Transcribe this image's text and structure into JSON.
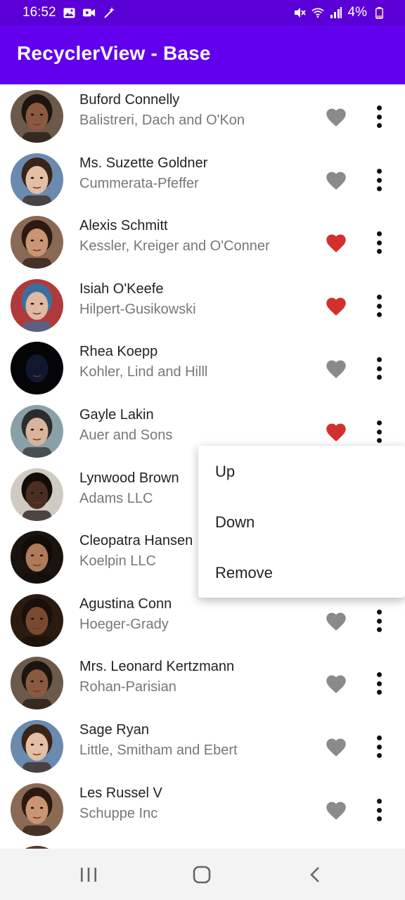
{
  "status_bar": {
    "time": "16:52",
    "battery": "4%",
    "left_icons": [
      "gallery-icon",
      "video-icon",
      "magic-wand-icon"
    ],
    "right_icons": [
      "mute-icon",
      "wifi-icon",
      "signal-icon",
      "battery-icon"
    ]
  },
  "app_bar": {
    "title": "RecyclerView - Base",
    "color": "#6200ee"
  },
  "list": {
    "items": [
      {
        "name": "Buford Connelly",
        "company": "Balistreri, Dach and O'Kon",
        "favorite": false,
        "skin": "#8a5a40",
        "hair": "#1e140e",
        "bg": "#6b5a4a"
      },
      {
        "name": "Ms. Suzette Goldner",
        "company": "Cummerata-Pfeffer",
        "favorite": false,
        "skin": "#e3bfa5",
        "hair": "#3a2418",
        "bg": "#6a8ab0"
      },
      {
        "name": "Alexis Schmitt",
        "company": "Kessler, Kreiger and O'Conner",
        "favorite": true,
        "skin": "#c99574",
        "hair": "#2a1a12",
        "bg": "#8a6a55"
      },
      {
        "name": "Isiah O'Keefe",
        "company": "Hilpert-Gusikowski",
        "favorite": true,
        "skin": "#e0b9a0",
        "hair": "#3b6fa0",
        "bg": "#b03a3a"
      },
      {
        "name": "Rhea Koepp",
        "company": "Kohler, Lind and Hilll",
        "favorite": false,
        "skin": "#101830",
        "hair": "#050508",
        "bg": "#050508"
      },
      {
        "name": "Gayle Lakin",
        "company": "Auer and Sons",
        "favorite": true,
        "skin": "#d9b39a",
        "hair": "#2c2c2c",
        "bg": "#8aa0a8"
      },
      {
        "name": "Lynwood Brown",
        "company": "Adams LLC",
        "favorite": false,
        "skin": "#4a2e22",
        "hair": "#150c08",
        "bg": "#cfcac2"
      },
      {
        "name": "Cleopatra Hansen",
        "company": "Koelpin LLC",
        "favorite": false,
        "skin": "#b07a5a",
        "hair": "#120c08",
        "bg": "#1a1410"
      },
      {
        "name": "Agustina Conn",
        "company": "Hoeger-Grady",
        "favorite": false,
        "skin": "#7a4a30",
        "hair": "#1a0f0a",
        "bg": "#2a1a10"
      },
      {
        "name": "Mrs. Leonard Kertzmann",
        "company": "Rohan-Parisian",
        "favorite": false,
        "skin": "#8a5a40",
        "hair": "#1e140e",
        "bg": "#6b5a4a"
      },
      {
        "name": "Sage Ryan",
        "company": "Little, Smitham and Ebert",
        "favorite": false,
        "skin": "#e3bfa5",
        "hair": "#3a2418",
        "bg": "#6a8ab0"
      },
      {
        "name": "Les Russel V",
        "company": "Schuppe Inc",
        "favorite": false,
        "skin": "#c99574",
        "hair": "#2a1a12",
        "bg": "#8a6a55"
      }
    ]
  },
  "popup_menu": {
    "items": [
      "Up",
      "Down",
      "Remove"
    ]
  },
  "colors": {
    "heart_active": "#d32f2f",
    "heart_inactive": "#8a8a8a",
    "status_bar": "#5a00d6"
  },
  "nav_bar": {
    "buttons": [
      "recent-apps-icon",
      "home-icon",
      "back-icon"
    ]
  }
}
